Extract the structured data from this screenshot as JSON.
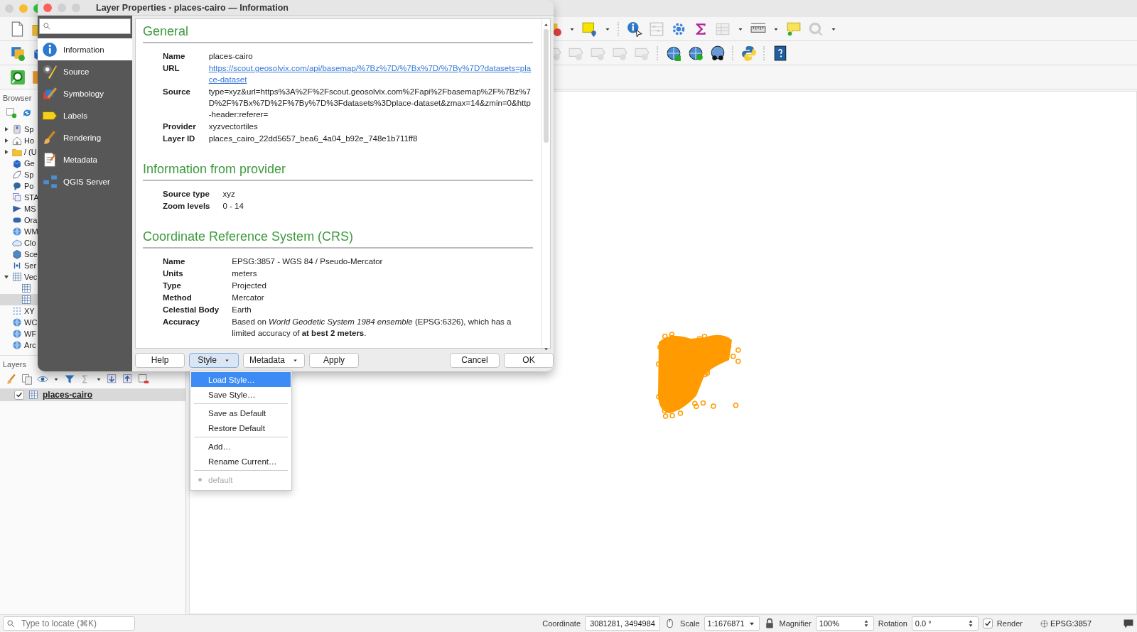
{
  "browser": {
    "title": "Browser",
    "items": [
      {
        "label": "Sp",
        "expanded": false,
        "selected": false
      },
      {
        "label": "Ho",
        "expanded": false,
        "selected": false
      },
      {
        "label": "/ (U",
        "expanded": false,
        "selected": false
      },
      {
        "label": "Ge",
        "selected": false
      },
      {
        "label": "Sp",
        "selected": false
      },
      {
        "label": "Po",
        "selected": false
      },
      {
        "label": "STA",
        "selected": false
      },
      {
        "label": "MS",
        "selected": false
      },
      {
        "label": "Ora",
        "selected": false
      },
      {
        "label": "WM",
        "selected": false
      },
      {
        "label": "Clo",
        "selected": false
      },
      {
        "label": "Sce",
        "selected": false
      },
      {
        "label": "Ser",
        "selected": false
      },
      {
        "label": "Vec",
        "expanded": true,
        "selected": false,
        "children": [
          {
            "selected": false
          },
          {
            "selected": true
          }
        ]
      },
      {
        "label": "XY",
        "selected": false
      },
      {
        "label": "WC",
        "selected": false
      },
      {
        "label": "WF",
        "selected": false
      },
      {
        "label": "Arc",
        "selected": false
      }
    ]
  },
  "layers": {
    "title": "Layers",
    "items": [
      {
        "label": "places-cairo",
        "checked": true,
        "selected": true
      }
    ]
  },
  "dialog": {
    "title": "Layer Properties - places-cairo — Information",
    "nav": [
      {
        "label": "Information",
        "selected": true
      },
      {
        "label": "Source",
        "selected": false
      },
      {
        "label": "Symbology",
        "selected": false
      },
      {
        "label": "Labels",
        "selected": false
      },
      {
        "label": "Rendering",
        "selected": false
      },
      {
        "label": "Metadata",
        "selected": false
      },
      {
        "label": "QGIS Server",
        "selected": false
      }
    ],
    "sections": [
      {
        "heading": "General",
        "rows": [
          {
            "label": "Name",
            "value": "places-cairo",
            "kind": "text"
          },
          {
            "label": "URL",
            "value": "https://scout.geosolvix.com/api/basemap/%7Bz%7D/%7Bx%7D/%7By%7D?datasets=place-dataset",
            "kind": "link"
          },
          {
            "label": "Source",
            "value": "type=xyz&url=https%3A%2F%2Fscout.geosolvix.com%2Fapi%2Fbasemap%2F%7Bz%7D%2F%7Bx%7D%2F%7By%7D%3Fdatasets%3Dplace-dataset&zmax=14&zmin=0&http-header:referer=",
            "kind": "text"
          },
          {
            "label": "Provider",
            "value": "xyzvectortiles",
            "kind": "text"
          },
          {
            "label": "Layer ID",
            "value": "places_cairo_22dd5657_bea6_4a04_b92e_748e1b711ff8",
            "kind": "text"
          }
        ]
      },
      {
        "heading": "Information from provider",
        "rows": [
          {
            "label": "Source type",
            "value": "xyz",
            "kind": "text"
          },
          {
            "label": "Zoom levels",
            "value": "0 - 14",
            "kind": "text"
          }
        ]
      },
      {
        "heading": "Coordinate Reference System (CRS)",
        "rows": [
          {
            "label": "Name",
            "value": "EPSG:3857 - WGS 84 / Pseudo-Mercator",
            "kind": "text"
          },
          {
            "label": "Units",
            "value": "meters",
            "kind": "text"
          },
          {
            "label": "Type",
            "value": "Projected",
            "kind": "text"
          },
          {
            "label": "Method",
            "value": "Mercator",
            "kind": "text"
          },
          {
            "label": "Celestial Body",
            "value": "Earth",
            "kind": "text"
          },
          {
            "label": "Accuracy",
            "value": "Based on *World Geodetic System 1984 ensemble* (EPSG:6326), which has a limited accuracy of **at best 2 meters**.",
            "kind": "text"
          }
        ]
      }
    ],
    "buttons_left": [
      {
        "label": "Help",
        "kind": "push"
      },
      {
        "label": "Style",
        "kind": "menu",
        "open": true
      },
      {
        "label": "Metadata",
        "kind": "menu",
        "open": false
      },
      {
        "label": "Apply",
        "kind": "push"
      }
    ],
    "buttons_right": [
      {
        "label": "Cancel"
      },
      {
        "label": "OK"
      }
    ]
  },
  "style_menu": {
    "groups": [
      [
        {
          "label": "Load Style…",
          "kind": "action",
          "selected": true,
          "disabled": false
        },
        {
          "label": "Save Style…",
          "kind": "action",
          "selected": false,
          "disabled": false
        }
      ],
      [
        {
          "label": "Save as Default",
          "kind": "action",
          "selected": false,
          "disabled": false
        },
        {
          "label": "Restore Default",
          "kind": "action",
          "selected": false,
          "disabled": false
        }
      ],
      [
        {
          "label": "Add…",
          "kind": "action",
          "selected": false,
          "disabled": false
        },
        {
          "label": "Rename Current…",
          "kind": "action",
          "selected": false,
          "disabled": false
        }
      ],
      [
        {
          "label": "default",
          "kind": "radio",
          "selected": false,
          "disabled": true
        }
      ]
    ]
  },
  "status_bar": {
    "locate": {
      "placeholder": "Type to locate (⌘K)"
    },
    "coordinate": {
      "label": "Coordinate",
      "value": "3081281, 3494984"
    },
    "scale": {
      "label": "Scale",
      "value": "1:1676871"
    },
    "magnifier": {
      "label": "Magnifier",
      "value": "100%"
    },
    "rotation": {
      "label": "Rotation",
      "value": "0.0 °"
    },
    "render": {
      "label": "Render",
      "checked": true
    },
    "crs": "EPSG:3857"
  }
}
